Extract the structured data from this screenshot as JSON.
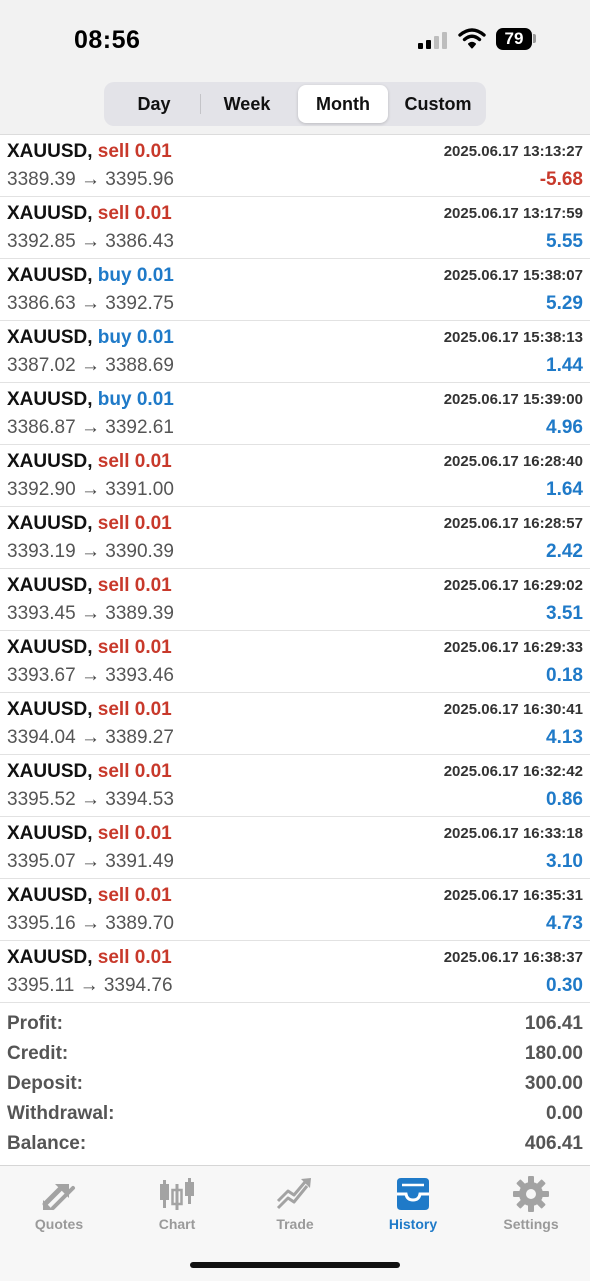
{
  "status_bar": {
    "time": "08:56",
    "battery": "79"
  },
  "period_tabs": [
    {
      "label": "Day",
      "active": false
    },
    {
      "label": "Week",
      "active": false
    },
    {
      "label": "Month",
      "active": true
    },
    {
      "label": "Custom",
      "active": false
    }
  ],
  "trades": [
    {
      "symbol": "XAUUSD,",
      "side": "sell 0.01",
      "direction": "sell",
      "datetime": "2025.06.17 13:13:27",
      "open": "3389.39",
      "arrow": "→",
      "close": "3395.96",
      "profit": "-5.68"
    },
    {
      "symbol": "XAUUSD,",
      "side": "sell 0.01",
      "direction": "sell",
      "datetime": "2025.06.17 13:17:59",
      "open": "3392.85",
      "arrow": "→",
      "close": "3386.43",
      "profit": "5.55"
    },
    {
      "symbol": "XAUUSD,",
      "side": "buy 0.01",
      "direction": "buy",
      "datetime": "2025.06.17 15:38:07",
      "open": "3386.63",
      "arrow": "→",
      "close": "3392.75",
      "profit": "5.29"
    },
    {
      "symbol": "XAUUSD,",
      "side": "buy 0.01",
      "direction": "buy",
      "datetime": "2025.06.17 15:38:13",
      "open": "3387.02",
      "arrow": "→",
      "close": "3388.69",
      "profit": "1.44"
    },
    {
      "symbol": "XAUUSD,",
      "side": "buy 0.01",
      "direction": "buy",
      "datetime": "2025.06.17 15:39:00",
      "open": "3386.87",
      "arrow": "→",
      "close": "3392.61",
      "profit": "4.96"
    },
    {
      "symbol": "XAUUSD,",
      "side": "sell 0.01",
      "direction": "sell",
      "datetime": "2025.06.17 16:28:40",
      "open": "3392.90",
      "arrow": "→",
      "close": "3391.00",
      "profit": "1.64"
    },
    {
      "symbol": "XAUUSD,",
      "side": "sell 0.01",
      "direction": "sell",
      "datetime": "2025.06.17 16:28:57",
      "open": "3393.19",
      "arrow": "→",
      "close": "3390.39",
      "profit": "2.42"
    },
    {
      "symbol": "XAUUSD,",
      "side": "sell 0.01",
      "direction": "sell",
      "datetime": "2025.06.17 16:29:02",
      "open": "3393.45",
      "arrow": "→",
      "close": "3389.39",
      "profit": "3.51"
    },
    {
      "symbol": "XAUUSD,",
      "side": "sell 0.01",
      "direction": "sell",
      "datetime": "2025.06.17 16:29:33",
      "open": "3393.67",
      "arrow": "→",
      "close": "3393.46",
      "profit": "0.18"
    },
    {
      "symbol": "XAUUSD,",
      "side": "sell 0.01",
      "direction": "sell",
      "datetime": "2025.06.17 16:30:41",
      "open": "3394.04",
      "arrow": "→",
      "close": "3389.27",
      "profit": "4.13"
    },
    {
      "symbol": "XAUUSD,",
      "side": "sell 0.01",
      "direction": "sell",
      "datetime": "2025.06.17 16:32:42",
      "open": "3395.52",
      "arrow": "→",
      "close": "3394.53",
      "profit": "0.86"
    },
    {
      "symbol": "XAUUSD,",
      "side": "sell 0.01",
      "direction": "sell",
      "datetime": "2025.06.17 16:33:18",
      "open": "3395.07",
      "arrow": "→",
      "close": "3391.49",
      "profit": "3.10"
    },
    {
      "symbol": "XAUUSD,",
      "side": "sell 0.01",
      "direction": "sell",
      "datetime": "2025.06.17 16:35:31",
      "open": "3395.16",
      "arrow": "→",
      "close": "3389.70",
      "profit": "4.73"
    },
    {
      "symbol": "XAUUSD,",
      "side": "sell 0.01",
      "direction": "sell",
      "datetime": "2025.06.17 16:38:37",
      "open": "3395.11",
      "arrow": "→",
      "close": "3394.76",
      "profit": "0.30"
    }
  ],
  "summary": [
    {
      "label": "Profit:",
      "value": "106.41"
    },
    {
      "label": "Credit:",
      "value": "180.00"
    },
    {
      "label": "Deposit:",
      "value": "300.00"
    },
    {
      "label": "Withdrawal:",
      "value": "0.00"
    },
    {
      "label": "Balance:",
      "value": "406.41"
    }
  ],
  "bottom_tabs": [
    {
      "label": "Quotes",
      "icon": "quotes-arrows-icon",
      "active": false
    },
    {
      "label": "Chart",
      "icon": "candlestick-icon",
      "active": false
    },
    {
      "label": "Trade",
      "icon": "trend-up-icon",
      "active": false
    },
    {
      "label": "History",
      "icon": "inbox-tray-icon",
      "active": true
    },
    {
      "label": "Settings",
      "icon": "gear-icon",
      "active": false
    }
  ],
  "colors": {
    "accent": "#1f7ac8",
    "sell": "#c8392b",
    "buy": "#1f7ac8",
    "profit_positive": "#1f7ac8",
    "profit_negative": "#c8392b",
    "tab_inactive": "#9a9a9a"
  }
}
